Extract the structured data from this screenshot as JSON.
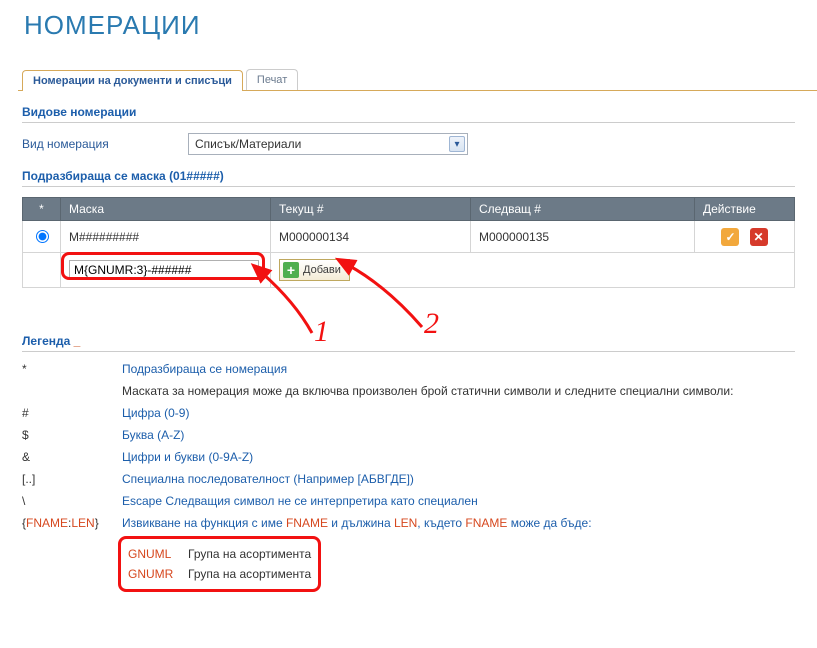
{
  "page_title": "НОМЕРАЦИИ",
  "tabs": [
    {
      "label": "Номерации на документи и списъци",
      "active": true
    },
    {
      "label": "Печат",
      "active": false
    }
  ],
  "sec_types": {
    "title": "Видове номерации",
    "field_label": "Вид номерация",
    "select_value": "Списък/Материали"
  },
  "sec_mask": {
    "title": "Подразбираща се маска (01#####)",
    "headers": {
      "star": "*",
      "mask": "Маска",
      "current": "Текущ #",
      "next": "Следващ #",
      "action": "Действие"
    },
    "rows": [
      {
        "mask": "M#########",
        "current": "M000000134",
        "next": "M000000135"
      }
    ],
    "new_mask_value": "M{GNUMR:3}-######",
    "add_label": "Добави"
  },
  "annotations": {
    "one": "1",
    "two": "2"
  },
  "legend": {
    "title": "Легенда",
    "underscore": "_",
    "rows": [
      {
        "sym": "*",
        "desc": "Подразбираща се номерация",
        "link": true
      },
      {
        "sym": "",
        "desc": "Маската за номерация може да включва произволен брой статични символи и следните специални символи:",
        "link": false
      },
      {
        "sym": "#",
        "desc": "Цифра (0-9)",
        "link": true
      },
      {
        "sym": "$",
        "desc": "Буква (A-Z)",
        "link": true
      },
      {
        "sym": "&",
        "desc": "Цифри и букви (0-9A-Z)",
        "link": true
      },
      {
        "sym": "[..]",
        "desc": "Специална последователност (Например [АБВГДЕ])",
        "link": true
      },
      {
        "sym": "\\",
        "desc": "Escape Следващия символ не се интерпретира като специален",
        "link": true
      }
    ],
    "fname_row": {
      "sym": "{FNAME:LEN}",
      "pre": "Извикване на функция с име ",
      "mid1": "FNAME",
      "mid2": " и дължина ",
      "mid3": "LEN",
      "mid4": ", където ",
      "mid5": "FNAME",
      "post": " може да бъде:"
    },
    "funcs": [
      {
        "name": "GNUML",
        "desc": "Група на асортимента"
      },
      {
        "name": "GNUMR",
        "desc": "Група на асортимента"
      }
    ]
  }
}
